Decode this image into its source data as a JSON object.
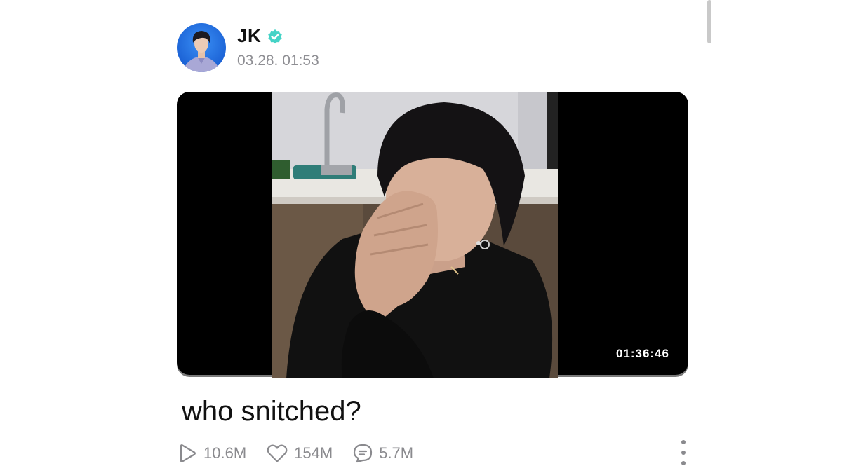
{
  "post": {
    "author": "JK",
    "verified": true,
    "timestamp": "03.28. 01:53",
    "title": "who snitched?",
    "video": {
      "duration": "01:36:46"
    },
    "stats": {
      "plays": "10.6M",
      "likes": "154M",
      "comments": "5.7M"
    }
  },
  "icons": {
    "verified": "verified-badge-icon",
    "plays": "play-icon",
    "likes": "heart-icon",
    "comments": "comment-icon",
    "more": "more-vertical-icon"
  },
  "colors": {
    "verified_badge": "#45d3c6",
    "muted_text": "#8e8e93",
    "avatar_bg": "#1c63d6"
  }
}
